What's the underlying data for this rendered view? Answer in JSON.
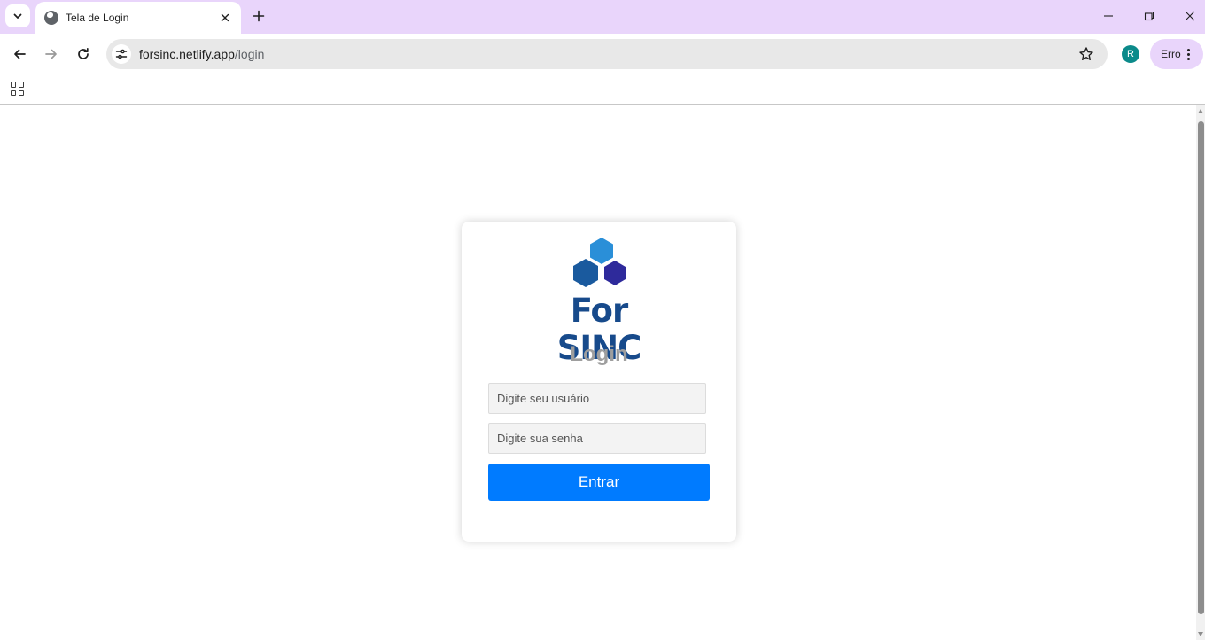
{
  "browser": {
    "tab": {
      "title": "Tela de Login",
      "icon": "globe-icon"
    },
    "omnibox": {
      "host": "forsinc.netlify.app",
      "path": "/login"
    },
    "profile": {
      "initial": "R",
      "color": "#0b8a8a"
    },
    "error_chip": {
      "label": "Erro"
    },
    "accent": "#e9d5fb"
  },
  "login": {
    "brand": "For SINC",
    "heading": "Login",
    "username_placeholder": "Digite seu usuário",
    "password_placeholder": "Digite sua senha",
    "submit_label": "Entrar",
    "colors": {
      "brand": "#174a8b",
      "button": "#007bff",
      "hex_light": "#2a8fd8",
      "hex_dark": "#1a5a9e",
      "hex_purple": "#2e2a9b"
    }
  }
}
